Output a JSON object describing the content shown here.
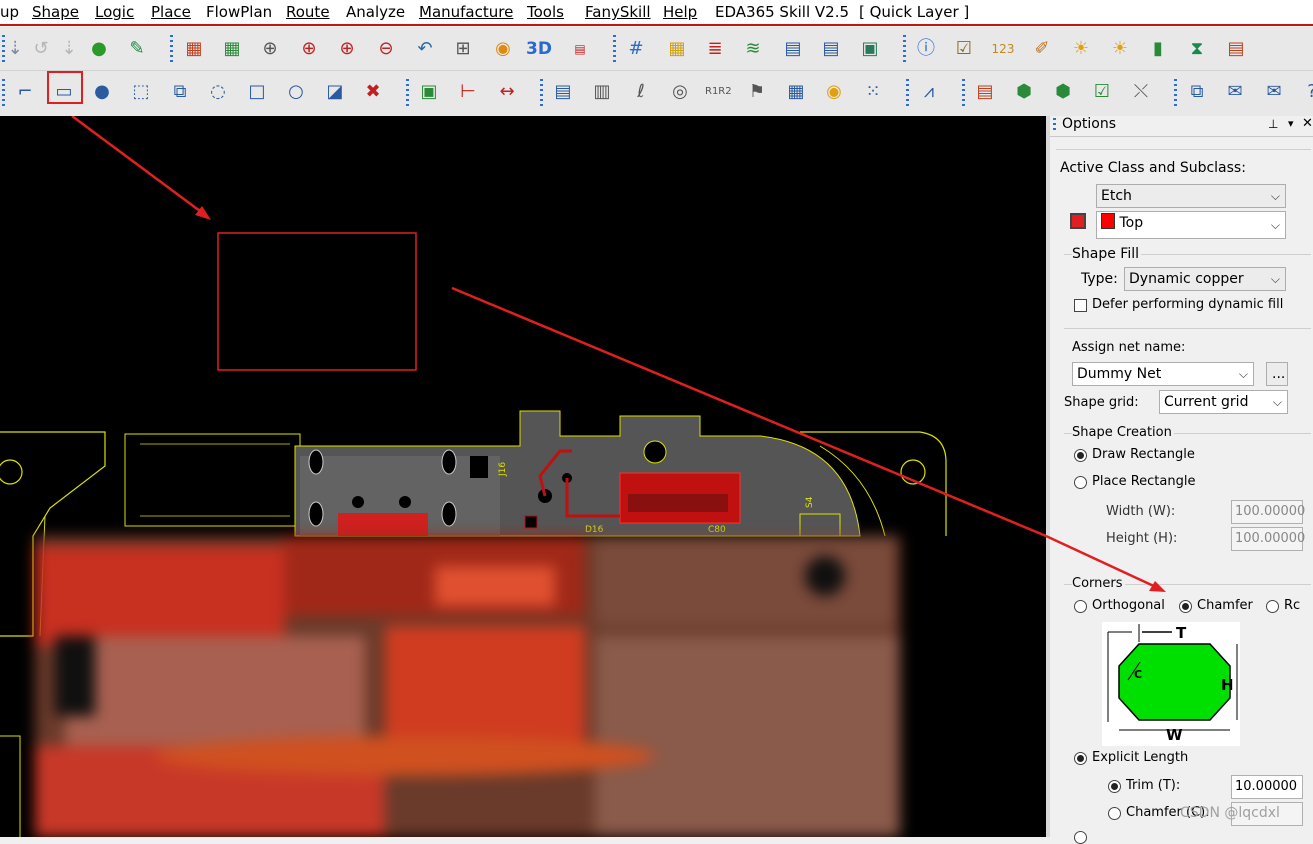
{
  "menu": [
    "up",
    "Shape",
    "Logic",
    "Place",
    "FlowPlan",
    "Route",
    "Analyze",
    "Manufacture",
    "Tools",
    "FanySkill",
    "Help",
    "EDA365 Skill V2.5",
    "[ Quick Layer ]"
  ],
  "toolbar_row1_icons": [
    "down-arrow",
    "undo",
    "down-arrow-gray",
    "globe",
    "pin",
    "grid-box",
    "grid-box-2",
    "zoom-fit",
    "zoom-in-area",
    "zoom-in",
    "zoom-out",
    "zoom-previous",
    "zoom-world",
    "refresh",
    "3d-view",
    "flip",
    "grid-dots",
    "color-palette",
    "layers",
    "route-stack",
    "ecm",
    "dfa",
    "board-view",
    "info",
    "checklist",
    "ruler-123",
    "brush",
    "sun",
    "sun-settings",
    "bar-chart",
    "hourglass",
    "settings-list"
  ],
  "toolbar_row2_icons": [
    "l-shape",
    "rectangle",
    "circle",
    "select-shape",
    "merge-shapes",
    "rotate-shape",
    "square",
    "circle-outline",
    "edit-shape",
    "delete-shape",
    "pcb-chip",
    "dimension-horizontal",
    "dimension-width",
    "odb",
    "component",
    "ref-des",
    "camera",
    "r1r2-swap",
    "flag",
    "grid-select",
    "test-point",
    "array",
    "routing-path",
    "shape-list",
    "package",
    "package-2",
    "checkbox-list",
    "split",
    "stack",
    "email",
    "envelope",
    "help"
  ],
  "options": {
    "title": "Options",
    "active_class_label": "Active Class and Subclass:",
    "class_value": "Etch",
    "subclass_value": "Top",
    "subclass_color": "#ff0000",
    "shape_fill_label": "Shape Fill",
    "type_label": "Type:",
    "type_value": "Dynamic copper",
    "defer_label": "Defer performing dynamic fill",
    "assign_net_label": "Assign net name:",
    "net_value": "Dummy Net",
    "browse_label": "...",
    "shape_grid_label": "Shape grid:",
    "shape_grid_value": "Current grid",
    "shape_creation_label": "Shape Creation",
    "draw_rect_label": "Draw Rectangle",
    "place_rect_label": "Place Rectangle",
    "width_label": "Width (W):",
    "width_value": "100.00000",
    "height_label": "Height (H):",
    "height_value": "100.00000",
    "corners_label": "Corners",
    "orthogonal_label": "Orthogonal",
    "chamfer_label": "Chamfer",
    "round_label": "Rc",
    "diagram_labels": {
      "t": "T",
      "h": "H",
      "w": "W",
      "c": "C"
    },
    "explicit_length_label": "Explicit Length",
    "trim_label": "Trim (T):",
    "trim_value": "10.00000",
    "chamfer_c_label": "Chamfer (C):",
    "watermark": "CSDN @lqcdxl"
  },
  "board_labels": [
    "J16",
    "D16",
    "C80",
    "S4"
  ],
  "colors": {
    "accent_red": "#e02020",
    "board_outline": "#e0e000",
    "copper": "#c01010"
  }
}
